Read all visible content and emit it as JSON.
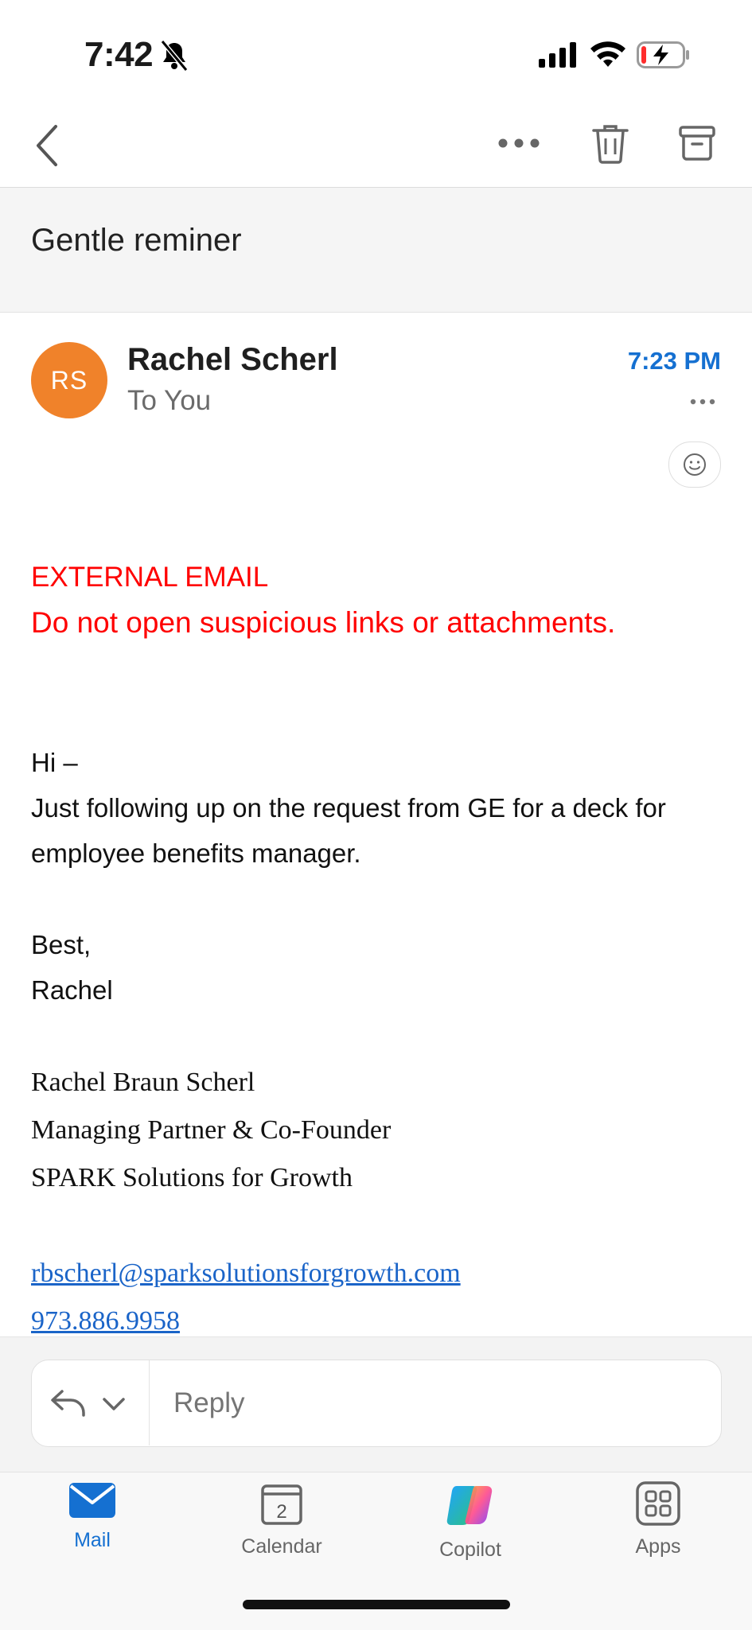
{
  "status_bar": {
    "time": "7:42"
  },
  "message": {
    "subject": "Gentle reminer",
    "avatar_initials": "RS",
    "sender": "Rachel Scherl",
    "recipient": "To You",
    "time": "7:23 PM",
    "warning_title": "EXTERNAL EMAIL",
    "warning_text": "Do not open suspicious links or attachments.",
    "body": [
      "Hi –",
      "Just following up on the request from GE for a deck for",
      "employee benefits manager.",
      "Best,",
      "Rachel"
    ],
    "signature": {
      "name": "Rachel Braun Scherl",
      "title": "Managing Partner & Co-Founder",
      "company": "SPARK Solutions for Growth",
      "email": "rbscherl@sparksolutionsforgrowth.com",
      "phone": "973.886.9958"
    }
  },
  "reply": {
    "placeholder": "Reply"
  },
  "tabs": [
    {
      "label": "Mail",
      "icon": "mail-icon"
    },
    {
      "label": "Calendar",
      "icon": "calendar-icon",
      "badge": "2"
    },
    {
      "label": "Copilot",
      "icon": "copilot-icon"
    },
    {
      "label": "Apps",
      "icon": "apps-icon"
    }
  ],
  "colors": {
    "accent": "#1570d1",
    "avatar": "#f0822a",
    "warning": "#ff0000"
  }
}
